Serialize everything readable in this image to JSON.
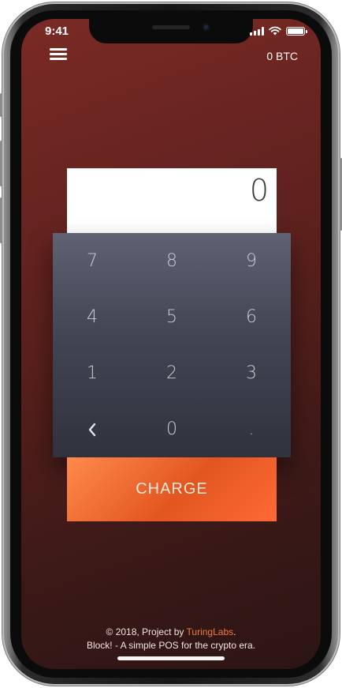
{
  "status_bar": {
    "time": "9:41",
    "icons": [
      "signal-icon",
      "wifi-icon",
      "battery-icon"
    ]
  },
  "header": {
    "menu_icon": "hamburger-menu-icon",
    "balance": "0 BTC"
  },
  "amount": {
    "value": "0"
  },
  "keypad": {
    "rows": [
      [
        "7",
        "8",
        "9"
      ],
      [
        "4",
        "5",
        "6"
      ],
      [
        "1",
        "2",
        "3"
      ],
      [
        "back",
        "0",
        "."
      ]
    ],
    "back_icon": "chevron-left-icon"
  },
  "charge_button": {
    "label": "CHARGE"
  },
  "footer": {
    "line1_prefix": "© 2018, Project by ",
    "line1_link": "TuringLabs",
    "line1_suffix": ".",
    "line2": "Block! - A simple POS for the crypto era."
  },
  "colors": {
    "background": "#5a201c",
    "accent": "#f07a3e",
    "charge_start": "#ff8a4c",
    "charge_end": "#e2561f",
    "keypad": "#434554"
  }
}
